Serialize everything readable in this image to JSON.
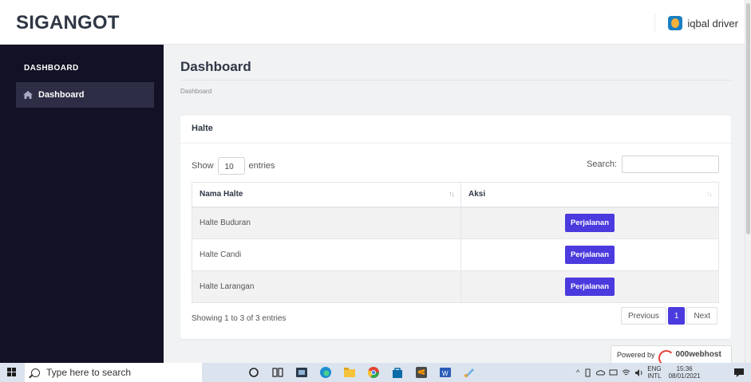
{
  "header": {
    "brand": "SIGANGOT",
    "username": "iqbal driver"
  },
  "sidebar": {
    "heading": "DASHBOARD",
    "items": [
      {
        "label": "Dashboard",
        "icon": "home-icon"
      }
    ]
  },
  "main": {
    "title": "Dashboard",
    "breadcrumb": "Dashboard",
    "card_title": "Halte",
    "length": {
      "show": "Show",
      "value": "10",
      "entries": "entries"
    },
    "search_label": "Search:",
    "columns": [
      "Nama Halte",
      "Aksi"
    ],
    "rows": [
      {
        "name": "Halte Buduran",
        "action": "Perjalanan"
      },
      {
        "name": "Halte Candi",
        "action": "Perjalanan"
      },
      {
        "name": "Halte Larangan",
        "action": "Perjalanan"
      }
    ],
    "info": "Showing 1 to 3 of 3 entries",
    "pagination": {
      "previous": "Previous",
      "current": "1",
      "next": "Next"
    }
  },
  "powered": {
    "text": "Powered by",
    "brand": "000webhost"
  },
  "taskbar": {
    "search_placeholder": "Type here to search",
    "lang_top": "ENG",
    "lang_bottom": "INTL",
    "time": "15:36",
    "date": "08/01/2021"
  },
  "colors": {
    "sidebar_bg": "#121125",
    "sidebar_active": "#2d2d46",
    "accent": "#4b3bde"
  }
}
